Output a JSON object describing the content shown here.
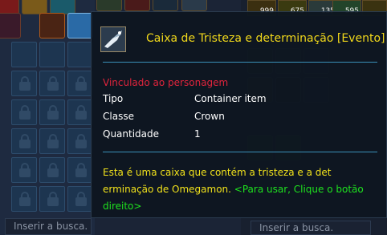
{
  "inventory": {
    "search_placeholder": "Inserir a busca."
  },
  "hud": {
    "counts": [
      "999",
      "675",
      "135",
      "595"
    ],
    "search_placeholder": "Inserir a busca."
  },
  "tooltip": {
    "title": "Caixa de Tristeza e determinação [Evento]",
    "icon": "box-item-icon",
    "bound": "Vinculado ao personagem",
    "rows": [
      {
        "label": "Tipo",
        "value": "Container item"
      },
      {
        "label": "Classe",
        "value": "Crown"
      },
      {
        "label": "Quantidade",
        "value": "1"
      }
    ],
    "description": "Esta é uma caixa que contém a tristeza e a det erminação de Omegamon.",
    "hint": "<Para usar, Clique o botão direito>"
  },
  "colors": {
    "title": "#f1d81b",
    "bound": "#e0243c",
    "description": "#f1e21b",
    "hint": "#1ee31e",
    "separator": "#3a90b8"
  }
}
